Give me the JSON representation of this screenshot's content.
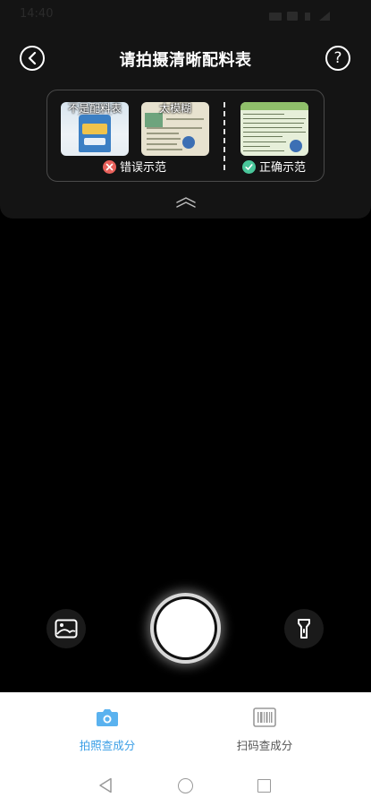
{
  "status_bar": {
    "time": "14:40"
  },
  "header": {
    "title": "请拍摄清晰配料表",
    "back_icon": "chevron-left-icon",
    "help_icon": "question-mark-icon",
    "help_glyph": "?"
  },
  "examples": {
    "wrong_thumbs": [
      {
        "label": "不是配料表"
      },
      {
        "label": "太模糊"
      }
    ],
    "wrong_caption": "错误示范",
    "right_caption": "正确示范"
  },
  "camera_controls": {
    "gallery_icon": "image-gallery-icon",
    "shutter_icon": "shutter-button",
    "flash_icon": "flashlight-icon"
  },
  "bottom_tabs": [
    {
      "label": "拍照查成分",
      "icon": "camera-icon",
      "active": true
    },
    {
      "label": "扫码查成分",
      "icon": "barcode-icon",
      "active": false
    }
  ],
  "colors": {
    "accent": "#3a9ee6",
    "wrong": "#e8615b",
    "right": "#49c69a"
  }
}
